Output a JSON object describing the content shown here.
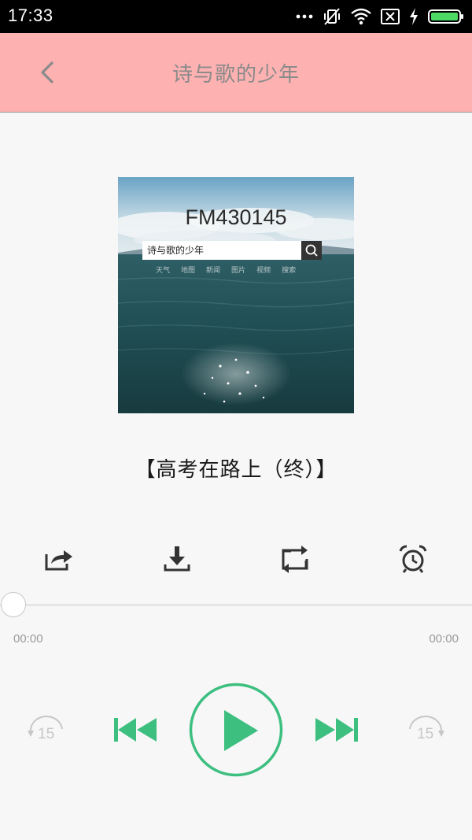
{
  "status_bar": {
    "time": "17:33",
    "icons": [
      "more-dots-icon",
      "mute-vibrate-icon",
      "wifi-icon",
      "sim-x-icon",
      "charging-bolt-icon",
      "battery-icon"
    ]
  },
  "app_bar": {
    "title": "诗与歌的少年",
    "back_icon": "chevron-left-icon",
    "background": "#fdb1b1"
  },
  "cover": {
    "fm_code": "FM430145",
    "search_text": "诗与歌的少年",
    "categories": [
      "天气",
      "地图",
      "新闻",
      "图片",
      "视频",
      "搜索"
    ]
  },
  "track": {
    "title": "【高考在路上（终）】"
  },
  "actions": [
    {
      "icon": "share-icon"
    },
    {
      "icon": "download-icon"
    },
    {
      "icon": "repeat-icon"
    },
    {
      "icon": "alarm-clock-icon"
    }
  ],
  "progress": {
    "fraction": 0,
    "elapsed": "00:00",
    "total": "00:00"
  },
  "controls": {
    "rewind_seconds": "15",
    "forward_seconds": "15",
    "accent_color": "#3dbf80",
    "play_icon": "play-icon"
  }
}
